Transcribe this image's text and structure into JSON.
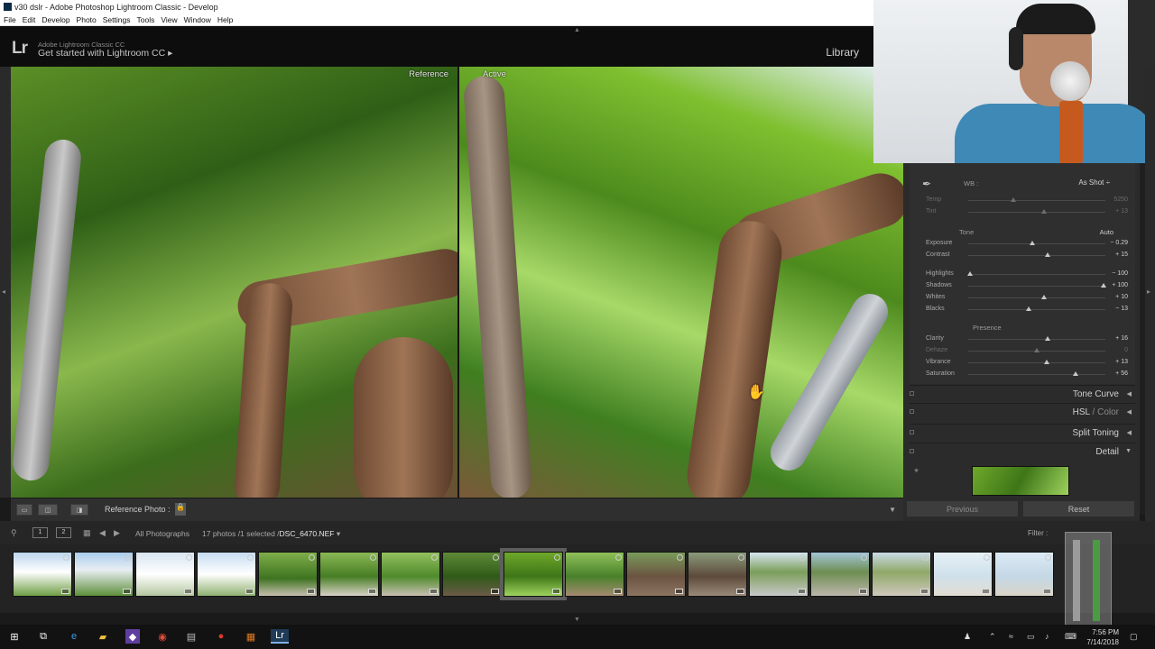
{
  "window": {
    "title": "v30 dslr - Adobe Photoshop Lightroom Classic - Develop"
  },
  "menu": [
    "File",
    "Edit",
    "Develop",
    "Photo",
    "Settings",
    "Tools",
    "View",
    "Window",
    "Help"
  ],
  "identity": {
    "logo": "Lr",
    "line1": "Adobe Lightroom Classic CC",
    "line2": "Get started with Lightroom CC",
    "arrow": "▸",
    "module": "Library"
  },
  "views": {
    "reference_label": "Reference",
    "active_label": "Active"
  },
  "basic": {
    "wb_label": "WB :",
    "wb_value": "As Shot ÷",
    "tone_label": "Tone",
    "auto_label": "Auto",
    "presence_label": "Presence",
    "wb_sliders": [
      {
        "label": "Temp",
        "value": "5250",
        "pos": 0.33
      },
      {
        "label": "Tint",
        "value": "+ 13",
        "pos": 0.55
      }
    ],
    "tone_sliders": [
      {
        "label": "Exposure",
        "value": "− 0.29",
        "pos": 0.47
      },
      {
        "label": "Contrast",
        "value": "+ 15",
        "pos": 0.58
      },
      {
        "label": "Highlights",
        "value": "− 100",
        "pos": 0.01
      },
      {
        "label": "Shadows",
        "value": "+ 100",
        "pos": 0.99
      },
      {
        "label": "Whites",
        "value": "+ 10",
        "pos": 0.55
      },
      {
        "label": "Blacks",
        "value": "− 13",
        "pos": 0.44
      }
    ],
    "presence_sliders": [
      {
        "label": "Clarity",
        "value": "+ 16",
        "pos": 0.58
      },
      {
        "label": "Dehaze",
        "value": "0",
        "pos": 0.5
      },
      {
        "label": "Vibrance",
        "value": "+ 13",
        "pos": 0.57
      },
      {
        "label": "Saturation",
        "value": "+ 56",
        "pos": 0.78
      }
    ]
  },
  "panels": {
    "tone_curve": "Tone Curve",
    "hsl": "HSL",
    "hsl_sep": " / ",
    "color": "Color",
    "split_toning": "Split Toning",
    "detail": "Detail"
  },
  "buttons": {
    "previous": "Previous",
    "reset": "Reset"
  },
  "toolbar": {
    "reference_photo": "Reference Photo :"
  },
  "filmstrip": {
    "source": "All Photographs",
    "count": "17 photos /1 selected /",
    "file": "DSC_6470.NEF",
    "filter": "Filter :",
    "thumb_count": 17,
    "selected_index": 8
  },
  "taskbar": {
    "time": "7:56 PM",
    "date": "7/14/2018"
  },
  "colors": {
    "panel_bg": "#2b2b2b",
    "accent_lr": "#7fb0e5"
  }
}
